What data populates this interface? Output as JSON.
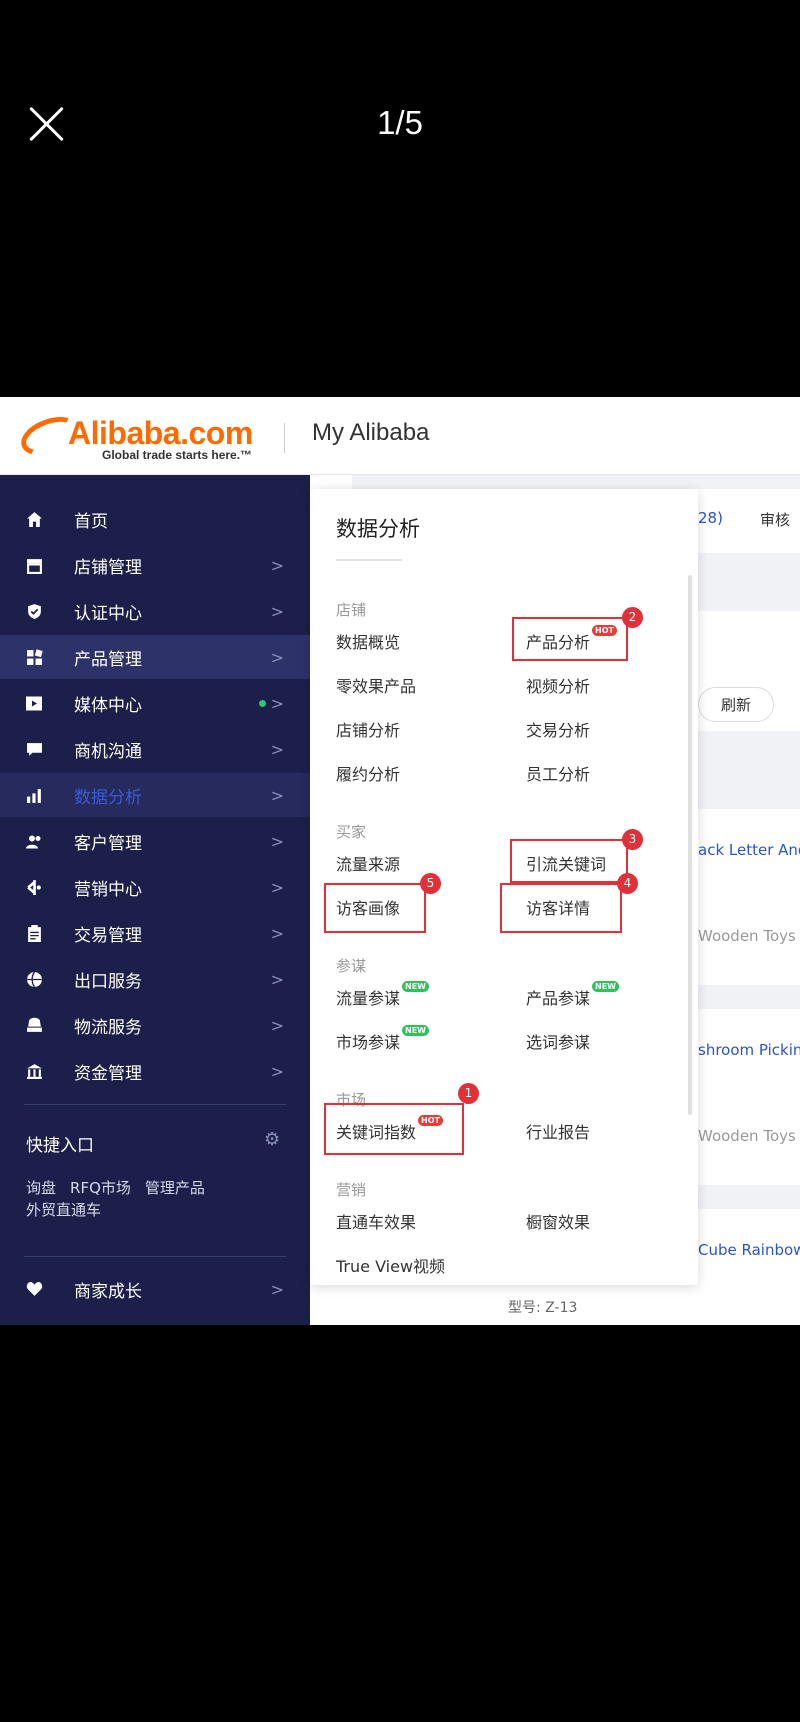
{
  "viewer": {
    "counter": "1/5"
  },
  "header": {
    "logo_text": "Alibaba",
    "logo_suffix": ".com",
    "logo_tagline": "Global trade starts here.™",
    "title": "My Alibaba"
  },
  "sidebar": {
    "items": [
      {
        "label": "首页",
        "icon": "home-icon"
      },
      {
        "label": "店铺管理",
        "icon": "store-icon"
      },
      {
        "label": "认证中心",
        "icon": "shield-icon"
      },
      {
        "label": "产品管理",
        "icon": "grid-icon"
      },
      {
        "label": "媒体中心",
        "icon": "video-icon"
      },
      {
        "label": "商机沟通",
        "icon": "chat-icon"
      },
      {
        "label": "数据分析",
        "icon": "bar-chart-icon"
      },
      {
        "label": "客户管理",
        "icon": "users-icon"
      },
      {
        "label": "营销中心",
        "icon": "marketing-icon"
      },
      {
        "label": "交易管理",
        "icon": "clipboard-icon"
      },
      {
        "label": "出口服务",
        "icon": "globe-icon"
      },
      {
        "label": "物流服务",
        "icon": "truck-icon"
      },
      {
        "label": "资金管理",
        "icon": "bank-icon"
      }
    ],
    "quick_title": "快捷入口",
    "quick_links": [
      "询盘",
      "RFQ市场",
      "管理产品",
      "外贸直通车"
    ],
    "growth_label": "商家成长"
  },
  "menu": {
    "title": "数据分析",
    "sections": {
      "store": "店铺",
      "buyer": "买家",
      "advisor": "参谋",
      "market": "市场",
      "marketing": "营销"
    },
    "items": {
      "data_overview": "数据概览",
      "product_analysis": "产品分析",
      "zero_effect": "零效果产品",
      "video_analysis": "视频分析",
      "store_analysis": "店铺分析",
      "trade_analysis": "交易分析",
      "fulfillment_analysis": "履约分析",
      "staff_analysis": "员工分析",
      "traffic_source": "流量来源",
      "traffic_keywords": "引流关键词",
      "visitor_profile": "访客画像",
      "visitor_details": "访客详情",
      "traffic_advisor": "流量参谋",
      "product_advisor": "产品参谋",
      "market_advisor": "市场参谋",
      "keyword_advisor": "选词参谋",
      "keyword_index": "关键词指数",
      "industry_report": "行业报告",
      "p4p_effect": "直通车效果",
      "showcase_effect": "橱窗效果",
      "true_view": "True View视频"
    },
    "badges": {
      "hot": "HOT",
      "new": "NEW"
    },
    "annotations": [
      "1",
      "2",
      "3",
      "4",
      "5"
    ]
  },
  "background": {
    "count": "28)",
    "review": "审核",
    "refresh": "刷新",
    "product1": "ack Letter And",
    "category1": "Wooden Toys",
    "product2": "shroom Picking",
    "category2": "Wooden Toys",
    "product3": "Cube Rainbow",
    "model": "型号: Z-13"
  }
}
